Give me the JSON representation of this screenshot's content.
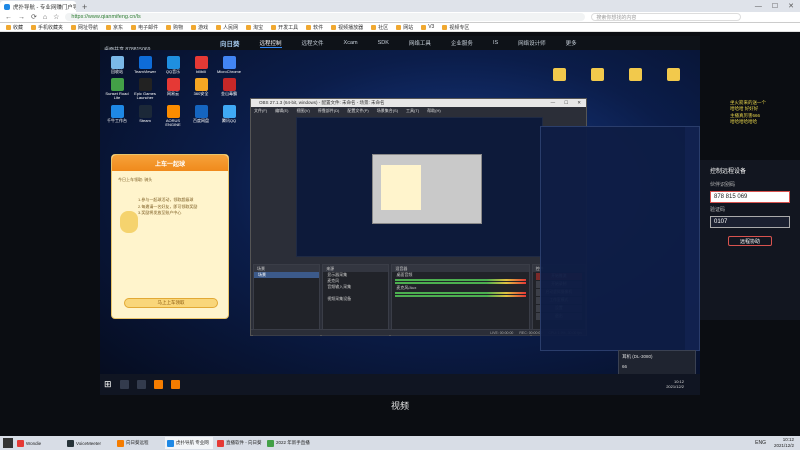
{
  "browser": {
    "tabs": [
      {
        "label": "虎扑导航 - 专业网赚门户导航 · 你的站点"
      },
      {
        "label": "",
        "new_tab": "+"
      }
    ],
    "url": "https://www.qianmifeng.cn/ls",
    "search_placeholder": "搜索你想找的内容",
    "bookmarks": [
      "收藏",
      "手机收藏夹",
      "网址导航",
      "京东",
      "电子邮件",
      "购物",
      "游戏",
      "人民网",
      "淘宝",
      "开发工具",
      "软件",
      "视频播放器",
      "社区",
      "网站",
      "V3",
      "视频专区"
    ],
    "win_ctrls": [
      "—",
      "☐",
      "✕"
    ]
  },
  "remote_header": {
    "logo": "向日葵",
    "nav": [
      "远程控制",
      "远程文件",
      "Xcam",
      "SDK",
      "网络工具",
      "企业服务",
      "IS",
      "网络设计师",
      "更多"
    ],
    "active_index": 0,
    "id_label": "桌面共享 878815069"
  },
  "desktop_icons": [
    {
      "label": "回收站",
      "color": "#7ab8e8"
    },
    {
      "label": "TeamViewer",
      "color": "#0e6cd8"
    },
    {
      "label": "QQ音乐",
      "color": "#1f8fe0"
    },
    {
      "label": "bilibili",
      "color": "#e53935"
    },
    {
      "label": "MicroChrome",
      "color": "#4285f4"
    },
    {
      "label": "Sunset Road Lite",
      "color": "#43a047"
    },
    {
      "label": "Epic Games Launcher",
      "color": "#222"
    },
    {
      "label": "网易云",
      "color": "#e53935"
    },
    {
      "label": "360安全",
      "color": "#f5a623"
    },
    {
      "label": "金山毒霸",
      "color": "#c62828"
    },
    {
      "label": "千牛工作台",
      "color": "#1e88e5"
    },
    {
      "label": "Steam",
      "color": "#1b2838"
    },
    {
      "label": "AORUS ENGINE",
      "color": "#fb8c00"
    },
    {
      "label": "百度网盘",
      "color": "#1565c0"
    },
    {
      "label": "腾讯QQ",
      "color": "#3fa9f5"
    }
  ],
  "popup": {
    "title": "上车一起球",
    "line1": "今日上车领取: 骑头",
    "line2": "1.参与一起球活动，领取超级球",
    "line3": "2.每邀请一名好友，即可领取奖励",
    "line4": "3.奖励将发放至账户中心",
    "button": "马上上车领取"
  },
  "obs": {
    "title": "OBS 27.1.3 (64-bit, windows) - 配置文件: 未命名 - 场景: 未命名",
    "menu": [
      "文件(F)",
      "编辑(E)",
      "视图(V)",
      "停靠部件(D)",
      "配置文件(P)",
      "场景集合(S)",
      "工具(T)",
      "帮助(H)"
    ],
    "panels": {
      "scenes_title": "场景",
      "scenes": [
        "场景"
      ],
      "sources_title": "来源",
      "sources": [
        "显示器采集",
        "麦克风",
        "音频输入采集",
        "",
        "视频采集设备"
      ],
      "mixer_title": "混音器",
      "mixer": [
        "桌面音频",
        "麦克风/Aux"
      ],
      "controls_title": "控件",
      "controls": [
        "开始推流",
        "开始录制",
        "启动虚拟摄像机",
        "工作室模式",
        "设置",
        "退出"
      ]
    },
    "status": [
      "LIVE: 00:00:00",
      "REC: 00:00:00",
      "CPU: 1.9%, 30.00 fps"
    ]
  },
  "volume_popup": {
    "device": "耳机 (DL-3080)",
    "level": "66"
  },
  "remote_taskbar": {
    "start": "⊞",
    "time": "10:12",
    "date": "2021/12/2"
  },
  "subtitle": "视频",
  "side_panel": {
    "title": "控制远程设备",
    "id_label": "伙伴识别码",
    "id_value": "878 815 069",
    "code_label": "验证码",
    "code_value": "0107",
    "button": "远程协助"
  },
  "danmu": [
    "坐火箭来的送一个",
    "哈哈哈 好好好",
    "主播真厉害666",
    "哈哈哈哈哈哈"
  ],
  "taskbar": {
    "items": [
      {
        "label": "Wondie",
        "color": "#e53935"
      },
      {
        "label": "VoiceMeeter",
        "color": "#263238"
      },
      {
        "label": "向日葵远程",
        "color": "#f57c00"
      },
      {
        "label": "虎扑导航 专业网",
        "color": "#1e88e5",
        "active": true
      },
      {
        "label": "直播软件 - 向日葵",
        "color": "#e53935"
      },
      {
        "label": "2022 年新手直播",
        "color": "#43a047"
      }
    ],
    "time": "10:12",
    "date": "2021/12/2",
    "ime": "ENG"
  }
}
